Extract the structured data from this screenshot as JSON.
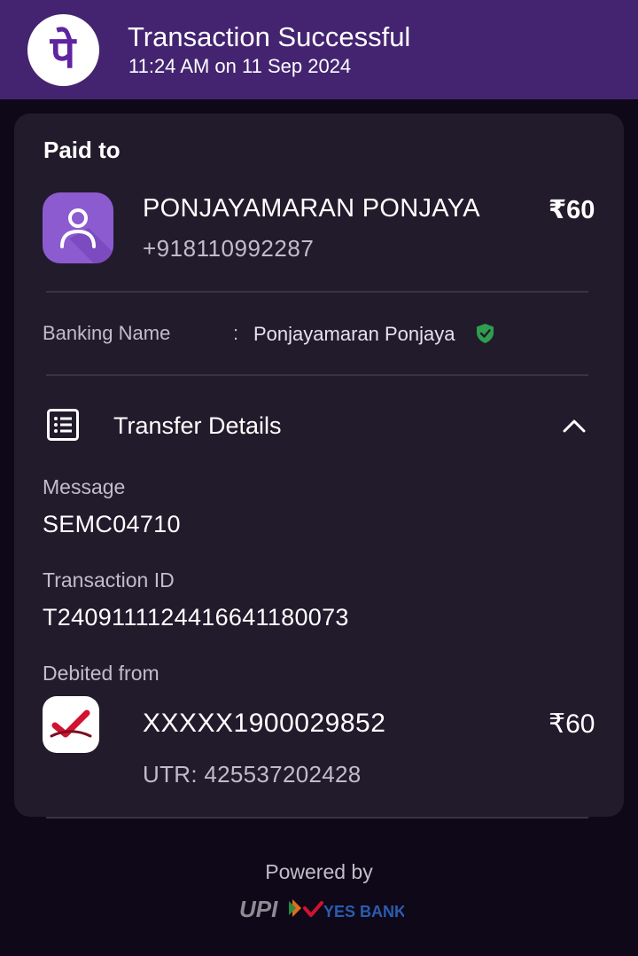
{
  "header": {
    "title": "Transaction Successful",
    "timestamp": "11:24 AM on 11 Sep 2024",
    "logo_icon": "phonepe-logo-icon",
    "brand_color": "#442470"
  },
  "payee": {
    "section_label": "Paid to",
    "avatar_icon": "person-icon",
    "name": "PONJAYAMARAN PONJAYA",
    "phone": "+918110992287",
    "amount": "₹60"
  },
  "banking": {
    "label": "Banking Name",
    "separator": ":",
    "value": "Ponjayamaran Ponjaya",
    "verified_icon": "verified-shield-icon",
    "verified_color": "#2e9e4f"
  },
  "transfer": {
    "title": "Transfer Details",
    "icon": "list-icon",
    "toggle_icon": "chevron-up-icon",
    "message_label": "Message",
    "message_value": "SEMC04710",
    "txn_label": "Transaction ID",
    "txn_value": "T2409111124416641180073",
    "debited_label": "Debited from",
    "bank_icon": "indian-bank-logo-icon",
    "account": "XXXXX1900029852",
    "account_amount": "₹60",
    "utr": "UTR: 425537202428"
  },
  "footer": {
    "powered_by": "Powered by",
    "upi_text": "UPI",
    "bank_text": "YES BANK"
  }
}
